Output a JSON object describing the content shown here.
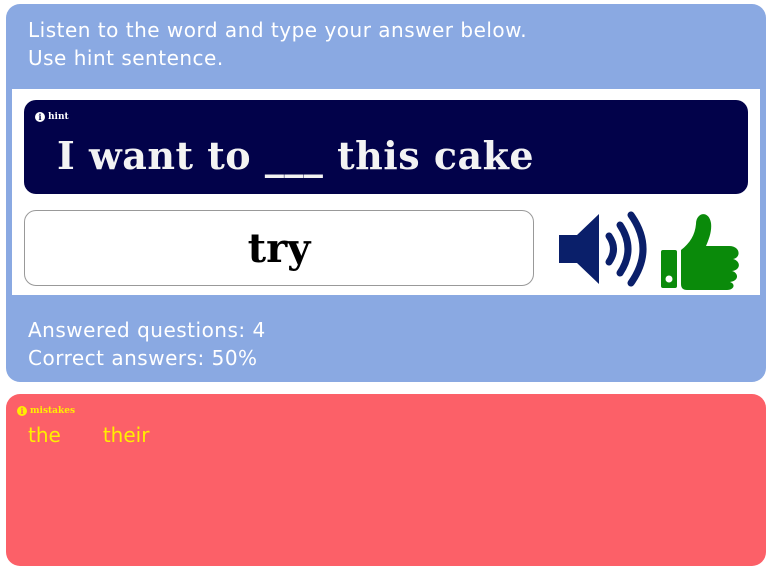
{
  "instructions": {
    "line1": "Listen to the word and type your answer below.",
    "line2": "Use hint sentence."
  },
  "hint": {
    "label": "hint",
    "sentence": "I want to ___ this cake"
  },
  "answer": {
    "value": "try"
  },
  "icons": {
    "speaker": "speaker-volume-icon",
    "feedback": "thumbs-up-icon",
    "info": "info-icon"
  },
  "stats": {
    "answered": "Answered questions: 4",
    "correct": "Correct answers: 50%"
  },
  "mistakes": {
    "label": "mistakes",
    "words": [
      "the",
      "their"
    ]
  },
  "colors": {
    "top_panel": "#8aa9e2",
    "hint_background": "#02024a",
    "mistakes_background": "#fc6068",
    "mistake_text": "#ffee00",
    "speaker": "#0a1f6a",
    "thumbs_up": "#0a8a0a"
  }
}
